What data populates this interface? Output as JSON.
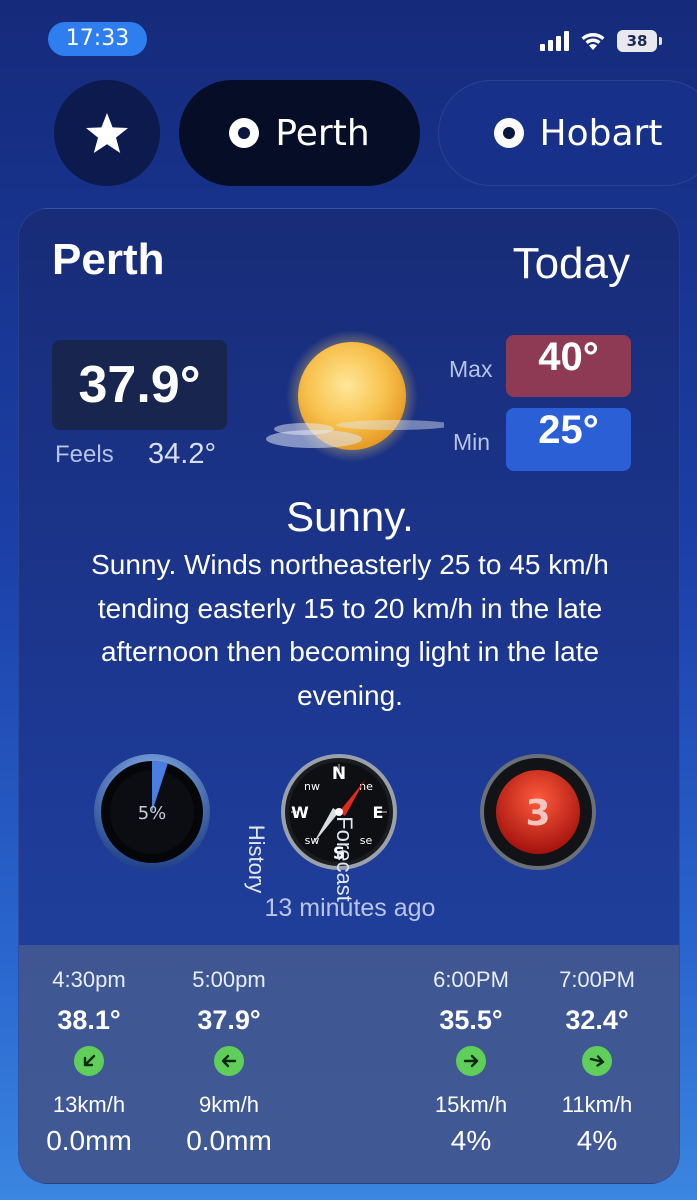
{
  "status": {
    "time": "17:33",
    "battery": "38"
  },
  "tabs": [
    {
      "label": "",
      "icon": "star-icon"
    },
    {
      "label": "Perth",
      "icon": "radio-icon"
    },
    {
      "label": "Hobart",
      "icon": "radio-icon"
    }
  ],
  "card": {
    "city": "Perth",
    "day": "Today",
    "current_temp": "37.9°",
    "feels_label": "Feels",
    "feels_value": "34.2°",
    "max_label": "Max",
    "max_value": "40°",
    "min_label": "Min",
    "min_value": "25°",
    "condition": "Sunny.",
    "forecast": "Sunny. Winds northeasterly 25 to 45 km/h tending easterly 15 to 20 km/h in the late afternoon then becoming light in the late evening.",
    "rain_chance": "5%",
    "rain_fraction": 0.05,
    "uv_index": "3",
    "compass": {
      "n": "N",
      "ne": "ne",
      "e": "E",
      "se": "se",
      "s": "S",
      "sw": "sw",
      "w": "W",
      "nw": "nw"
    },
    "updated": "13 minutes ago"
  },
  "hourly": {
    "history_label": "History",
    "forecast_label": "Forecast",
    "items": [
      {
        "time": "4:30pm",
        "temp": "38.1°",
        "direction": "arrow-down-left-icon",
        "wind": "13km/h",
        "rain": "0.0mm"
      },
      {
        "time": "5:00pm",
        "temp": "37.9°",
        "direction": "arrow-left-icon",
        "wind": "9km/h",
        "rain": "0.0mm"
      },
      {
        "time": "6:00PM",
        "temp": "35.5°",
        "direction": "arrow-right-icon",
        "wind": "15km/h",
        "rain": "4%"
      },
      {
        "time": "7:00PM",
        "temp": "32.4°",
        "direction": "arrow-down-right-icon",
        "wind": "11km/h",
        "rain": "4%"
      }
    ]
  },
  "colors": {
    "max_bg": "#8e3a55",
    "min_bg": "#2b5fd6",
    "wind_arrow": "#5fcf5a",
    "uv_red": "#d8261e"
  }
}
